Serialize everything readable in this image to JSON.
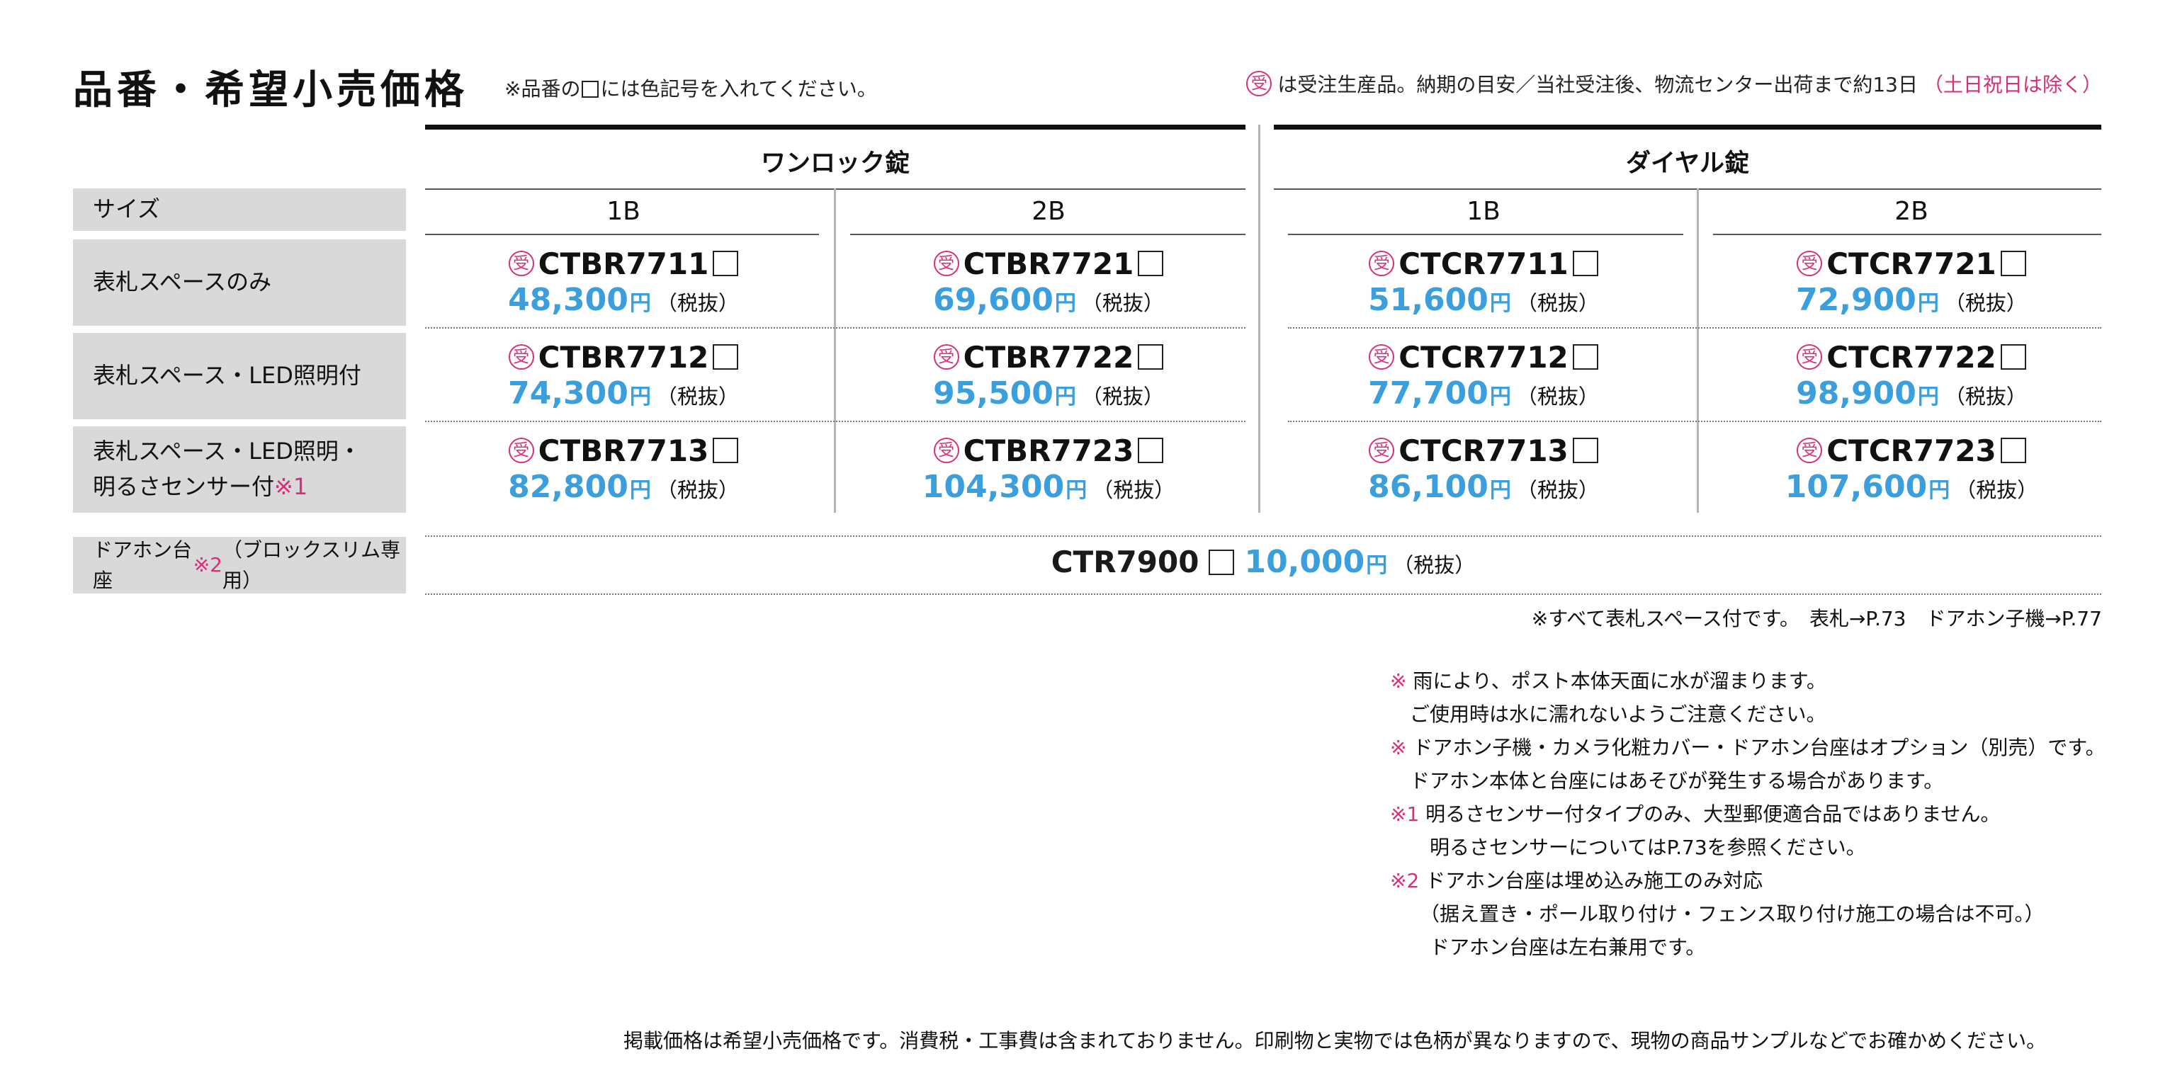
{
  "title": "品番・希望小売価格",
  "square_note": {
    "pre": "※品番の",
    "post": "には色記号を入れてください。"
  },
  "order_note": {
    "mark": "受",
    "text": "は受注生産品。納期の目安／当社受注後、物流センター出荷まで約13日",
    "paren": "（土日祝日は除く）"
  },
  "groups": [
    {
      "name": "ワンロック錠"
    },
    {
      "name": "ダイヤル錠"
    }
  ],
  "size_label": "サイズ",
  "sizes": [
    "1B",
    "2B",
    "1B",
    "2B"
  ],
  "rows": [
    {
      "label": "表札スペースのみ",
      "label2": "",
      "label2_mark": ""
    },
    {
      "label": "表札スペース・LED照明付",
      "label2": "",
      "label2_mark": ""
    },
    {
      "label": "表札スペース・LED照明・",
      "label2": "明るさセンサー付",
      "label2_mark": "※1"
    }
  ],
  "cells": [
    [
      {
        "model": "CTBR7711",
        "price": "48,300"
      },
      {
        "model": "CTBR7721",
        "price": "69,600"
      },
      {
        "model": "CTCR7711",
        "price": "51,600"
      },
      {
        "model": "CTCR7721",
        "price": "72,900"
      }
    ],
    [
      {
        "model": "CTBR7712",
        "price": "74,300"
      },
      {
        "model": "CTBR7722",
        "price": "95,500"
      },
      {
        "model": "CTCR7712",
        "price": "77,700"
      },
      {
        "model": "CTCR7722",
        "price": "98,900"
      }
    ],
    [
      {
        "model": "CTBR7713",
        "price": "82,800"
      },
      {
        "model": "CTBR7723",
        "price": "104,300"
      },
      {
        "model": "CTCR7713",
        "price": "86,100"
      },
      {
        "model": "CTCR7723",
        "price": "107,600"
      }
    ]
  ],
  "yen": "円",
  "tax": "（税抜）",
  "mark_ju": "受",
  "doorphone": {
    "label": "ドアホン台座",
    "mark": "※2",
    "label_suffix": "（ブロックスリム専用）",
    "model": "CTR7900",
    "price": "10,000"
  },
  "reference": "※すべて表札スペース付です。　表札→P.73　ドアホン子機→P.77",
  "notes": [
    {
      "mark": "※",
      "text": " 雨により、ポスト本体天面に水が溜まります。"
    },
    {
      "mark": "",
      "text": "　ご使用時は水に濡れないようご注意ください。"
    },
    {
      "mark": "※",
      "text": " ドアホン子機・カメラ化粧カバー・ドアホン台座はオプション（別売）です。"
    },
    {
      "mark": "",
      "text": "　ドアホン本体と台座にはあそびが発生する場合があります。"
    },
    {
      "mark": "※1",
      "text": " 明るさセンサー付タイプのみ、大型郵便適合品ではありません。"
    },
    {
      "mark": "",
      "text": "　　明るさセンサーについてはP.73を参照ください。"
    },
    {
      "mark": "※2",
      "text": " ドアホン台座は埋め込み施工のみ対応"
    },
    {
      "mark": "",
      "text": "　　（据え置き・ポール取り付け・フェンス取り付け施工の場合は不可。）"
    },
    {
      "mark": "",
      "text": "　　ドアホン台座は左右兼用です。"
    }
  ],
  "footer": "掲載価格は希望小売価格です。消費税・工事費は含まれておりません。印刷物と実物では色柄が異なりますので、現物の商品サンプルなどでお確かめください。",
  "colors": {
    "price_blue": "#3a9fdc",
    "accent_pink": "#d6307a",
    "label_gray": "#d9d9d9"
  }
}
